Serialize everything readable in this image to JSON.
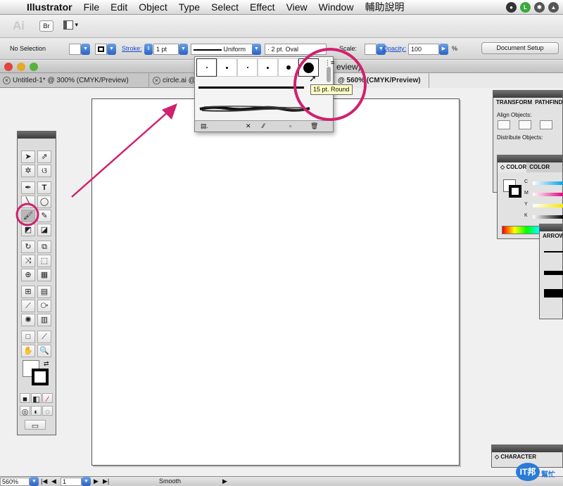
{
  "menubar": {
    "app_name": "Illustrator",
    "items": [
      "File",
      "Edit",
      "Object",
      "Type",
      "Select",
      "Effect",
      "View",
      "Window",
      "輔助說明"
    ]
  },
  "appbar": {
    "logo": "Ai",
    "bridge": "Br"
  },
  "controlbar": {
    "selection": "No Selection",
    "stroke_label": "Stroke:",
    "stroke_weight": "1 pt",
    "profile": "Uniform",
    "brush_def": "2 pt. Oval",
    "scale_label": "Scale:",
    "opacity_label": "Opacity:",
    "opacity_value": "100",
    "percent": "%",
    "doc_setup": "Document Setup"
  },
  "tabs": [
    {
      "label": "Untitled-1* @ 300% (CMYK/Preview)"
    },
    {
      "label": "circle.ai @"
    },
    {
      "label": "@ 560% (CMYK/Preview)"
    }
  ],
  "window_title_fragment": "eview)",
  "brush_popup": {
    "tooltip": "15 pt. Round",
    "brushes": [
      {
        "size": 1.5
      },
      {
        "size": 3
      },
      {
        "size": 2
      },
      {
        "size": 3
      },
      {
        "size": 6
      },
      {
        "size": 15
      }
    ]
  },
  "panels": {
    "transform_tabs": [
      "TRANSFORM",
      "PATHFINDER"
    ],
    "align_objects": "Align Objects:",
    "distribute_objects": "Distribute Objects:",
    "color_tab": "COLOR",
    "color_guide_tab": "COLOR",
    "cmyk_labels": [
      "C",
      "M",
      "Y",
      "K"
    ],
    "arrow_tab": "ARROW",
    "character_tab": "CHARACTER"
  },
  "status": {
    "zoom": "560%",
    "page": "1",
    "tool": "Smooth"
  },
  "watermark": {
    "text": "IT邦",
    "subtext": "幫忙"
  },
  "colors": {
    "annotation": "#d0216e",
    "selected_fill": "#1f5bc7"
  }
}
